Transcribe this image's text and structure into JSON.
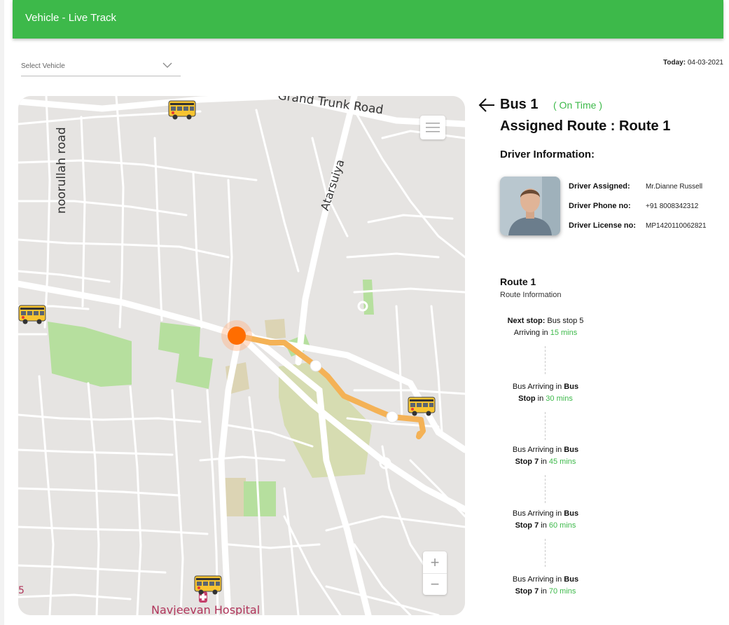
{
  "header": {
    "title": "Vehicle - Live Track"
  },
  "vehicle_select": {
    "placeholder": "Select Vehicle"
  },
  "date": {
    "label": "Today:",
    "value": "04-03-2021"
  },
  "map": {
    "labels": {
      "trunk_road": "Grand Trunk Road",
      "noorullah_road": "noorullah road",
      "atarsuiya": "Atarsuiya",
      "hospital": "Navjeevan Hospital"
    },
    "zoom_in": "+",
    "zoom_out": "−"
  },
  "bus": {
    "name": "Bus 1",
    "status": "( On Time )"
  },
  "assigned_route": "Assigned Route : Route 1",
  "driver": {
    "heading": "Driver Information:",
    "fields": [
      {
        "label": "Driver Assigned:",
        "value": "Mr.Dianne Russell"
      },
      {
        "label": "Driver Phone no:",
        "value": "+91 8008342312"
      },
      {
        "label": "Driver License no:",
        "value": "MP1420110062821"
      }
    ]
  },
  "route": {
    "name": "Route 1",
    "subtitle": "Route Information",
    "next_stop": {
      "label": "Next stop:",
      "stop": "Bus stop 5",
      "arriving": "Arriving in",
      "time": "15 mins"
    },
    "arrivals": [
      {
        "prefix": "Bus Arriving in",
        "stop": "Bus Stop",
        "mid": "in",
        "time": "30 mins"
      },
      {
        "prefix": "Bus Arriving in",
        "stop": "Bus Stop 7",
        "mid": "in",
        "time": "45 mins"
      },
      {
        "prefix": "Bus Arriving in",
        "stop": "Bus Stop 7",
        "mid": "in",
        "time": "60 mins"
      },
      {
        "prefix": "Bus Arriving in",
        "stop": "Bus Stop 7",
        "mid": "in",
        "time": "70 mins"
      }
    ]
  },
  "colors": {
    "brand": "#3db94a",
    "route_line": "#f4b256",
    "current_position": "#ff6d00"
  }
}
